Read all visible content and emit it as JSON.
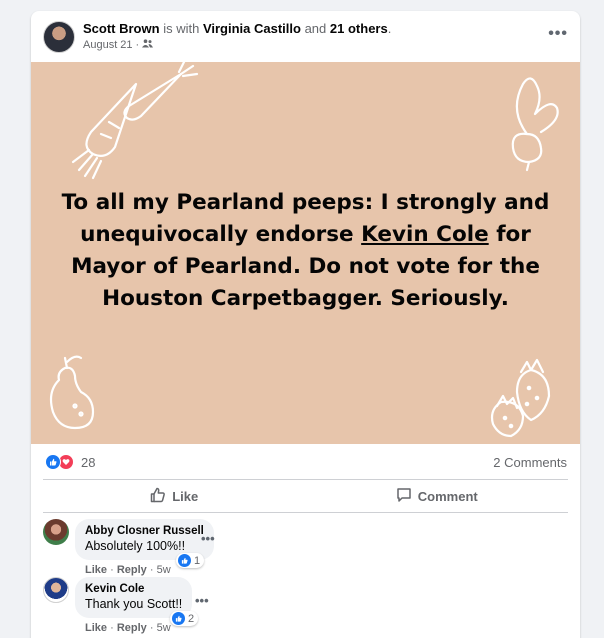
{
  "post": {
    "author": "Scott Brown",
    "with_text": "is with",
    "tagged": "Virginia Castillo",
    "and_text": "and",
    "others": "21 others",
    "date": "August 21",
    "more_label": "•••",
    "banner_lines": {
      "pre": "To all my Pearland peeps: I strongly and unequivocally endorse",
      "link": "Kevin Cole",
      "post": "for Mayor of Pearland. Do not vote for the Houston Carpetbagger. Seriously."
    },
    "banner_bg": "#e7c5ab",
    "reaction_count": "28",
    "comments_count": "2 Comments",
    "actions": {
      "like": "Like",
      "comment": "Comment"
    }
  },
  "comments": [
    {
      "name": "Abby Closner Russell",
      "text": "Absolutely 100%!!",
      "like": "Like",
      "reply": "Reply",
      "age": "5w",
      "reactions": "1"
    },
    {
      "name": "Kevin Cole",
      "text": "Thank you Scott!!",
      "like": "Like",
      "reply": "Reply",
      "age": "5w",
      "reactions": "2"
    }
  ],
  "icons": [
    "friends-icon",
    "more-icon",
    "like-reaction-icon",
    "love-reaction-icon",
    "thumbs-up-icon",
    "comment-icon"
  ],
  "colors": {
    "accent": "#1877f2",
    "love": "#f33e58"
  }
}
